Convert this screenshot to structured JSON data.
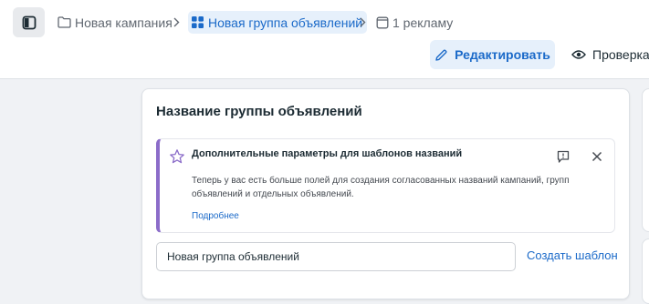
{
  "breadcrumb": {
    "campaign": "Новая кампания",
    "adset": "Новая группа объявлений",
    "ad": "1 рекламу"
  },
  "toolbar": {
    "edit_label": "Редактировать",
    "review_label": "Проверка"
  },
  "card": {
    "title": "Название группы объявлений",
    "notice": {
      "title": "Дополнительные параметры для шаблонов названий",
      "body": "Теперь у вас есть больше полей для создания согласованных названий кампаний, групп объявлений и отдельных объявлений.",
      "link": "Подробнее"
    },
    "name_input_value": "Новая группа объявлений",
    "create_template_label": "Создать шаблон"
  },
  "colors": {
    "accent": "#1b6ac9",
    "accent_bg": "#e6f0fb",
    "notice_border": "#8b6cc9",
    "page_bg": "#f0f2f5"
  },
  "icons": {
    "sidebar_toggle": "sidebar-panel-icon",
    "campaign": "folder-icon",
    "adset": "grid-icon",
    "ad": "ad-square-icon",
    "edit": "pencil-icon",
    "review": "eye-icon",
    "notice": "star-icon",
    "feedback": "feedback-flag-icon",
    "close": "close-icon"
  }
}
